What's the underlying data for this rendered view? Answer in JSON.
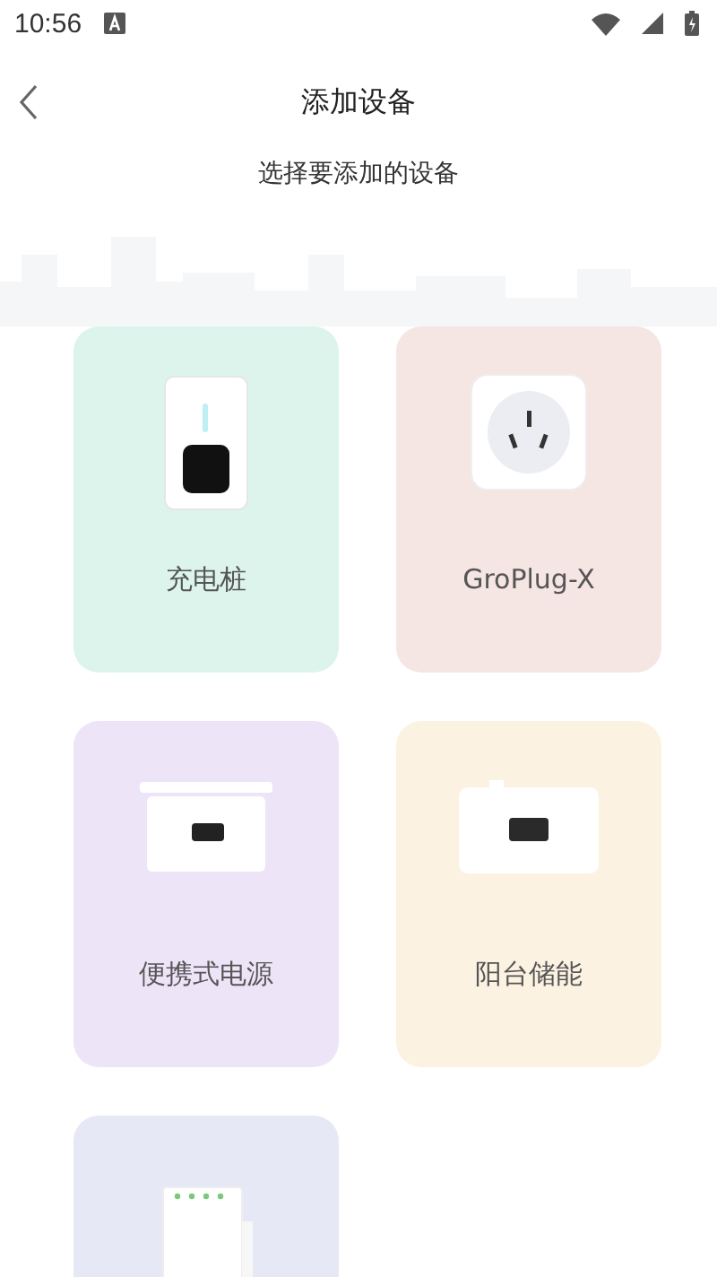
{
  "status_bar": {
    "time": "10:56"
  },
  "header": {
    "title": "添加设备"
  },
  "subtitle": "选择要添加的设备",
  "devices": [
    {
      "name": "充电桩",
      "kind": "charger",
      "color": "#dcf4ec"
    },
    {
      "name": "GroPlug-X",
      "kind": "plug",
      "color": "#f5e6e3"
    },
    {
      "name": "便携式电源",
      "kind": "portable",
      "color": "#eee4f8"
    },
    {
      "name": "阳台储能",
      "kind": "storage",
      "color": "#fcf2e2"
    },
    {
      "kind": "relay",
      "color": "#e6e9f5"
    }
  ]
}
